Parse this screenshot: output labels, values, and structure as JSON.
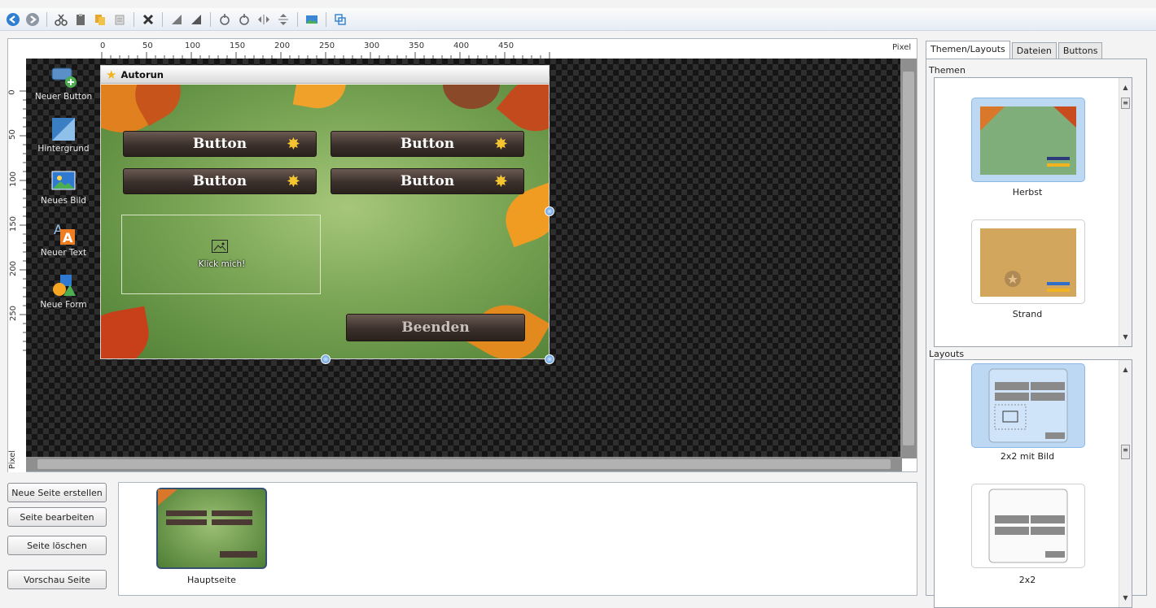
{
  "toolbar": {
    "icons": [
      "back-icon",
      "forward-icon",
      "cut-icon",
      "paste-icon",
      "copy-icon",
      "duplicate-icon",
      "delete-icon",
      "bring-front-icon",
      "send-back-icon",
      "rotate-left-icon",
      "rotate-right-icon",
      "flip-horizontal-icon",
      "flip-vertical-icon",
      "image-icon",
      "layers-icon"
    ]
  },
  "ruler": {
    "top_ticks": [
      "0",
      "50",
      "100",
      "150",
      "200",
      "250",
      "300",
      "350",
      "400",
      "450"
    ],
    "left_ticks": [
      "0",
      "50",
      "100",
      "150",
      "200",
      "250"
    ],
    "unit": "Pixel"
  },
  "tools": [
    {
      "label": "Neuer Button",
      "icon": "new-button-icon"
    },
    {
      "label": "Hintergrund",
      "icon": "background-icon"
    },
    {
      "label": "Neues Bild",
      "icon": "new-image-icon"
    },
    {
      "label": "Neuer Text",
      "icon": "new-text-icon"
    },
    {
      "label": "Neue Form",
      "icon": "new-shape-icon"
    }
  ],
  "window": {
    "title": "Autorun",
    "buttons": [
      "Button",
      "Button",
      "Button",
      "Button"
    ],
    "image_placeholder": "Klick mich!",
    "exit_button": "Beenden"
  },
  "right_panel": {
    "tabs": [
      "Themen/Layouts",
      "Dateien",
      "Buttons"
    ],
    "themes_label": "Themen",
    "themes": [
      "Herbst",
      "Strand"
    ],
    "layouts_label": "Layouts",
    "layouts": [
      "2x2 mit Bild",
      "2x2"
    ]
  },
  "pages": {
    "buttons": [
      "Neue Seite erstellen",
      "Seite bearbeiten",
      "Seite löschen",
      "Vorschau Seite"
    ],
    "items": [
      "Hauptseite"
    ]
  },
  "colors": {
    "canvas": "#2e2e2e",
    "selection": "#bcd8f3",
    "accent": "#3b7fd0"
  }
}
